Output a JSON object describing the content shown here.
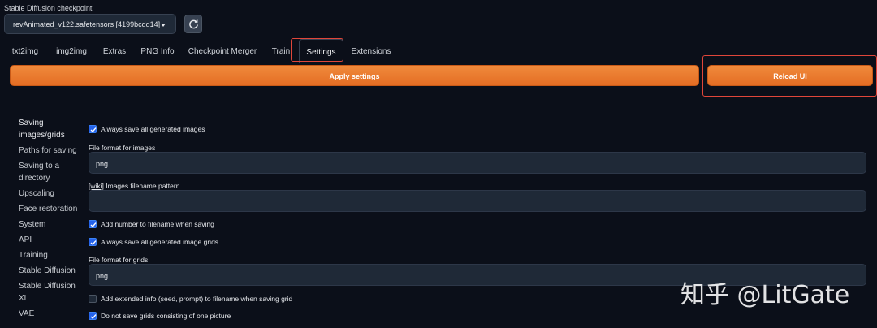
{
  "checkpoint": {
    "label": "Stable Diffusion checkpoint",
    "value": "revAnimated_v122.safetensors [4199bcdd14]",
    "refresh_icon": "refresh-icon"
  },
  "tabs": [
    {
      "label": "txt2img"
    },
    {
      "label": "img2img"
    },
    {
      "label": "Extras"
    },
    {
      "label": "PNG Info"
    },
    {
      "label": "Checkpoint Merger"
    },
    {
      "label": "Train"
    },
    {
      "label": "Settings",
      "active": true
    },
    {
      "label": "Extensions"
    }
  ],
  "actions": {
    "apply_label": "Apply settings",
    "reload_label": "Reload UI"
  },
  "sidebar": {
    "items": [
      {
        "label": "Saving images/grids",
        "active": true
      },
      {
        "label": "Paths for saving"
      },
      {
        "label": "Saving to a directory"
      },
      {
        "label": "Upscaling"
      },
      {
        "label": "Face restoration"
      },
      {
        "label": "System"
      },
      {
        "label": "API"
      },
      {
        "label": "Training"
      },
      {
        "label": "Stable Diffusion"
      },
      {
        "label": "Stable Diffusion XL"
      },
      {
        "label": "VAE"
      }
    ]
  },
  "settings": {
    "always_save_images": {
      "label": "Always save all generated images",
      "checked": true
    },
    "file_format_images": {
      "label": "File format for images",
      "value": "png"
    },
    "filename_pattern": {
      "wiki": "[wiki]",
      "label": " Images filename pattern",
      "value": ""
    },
    "add_number": {
      "label": "Add number to filename when saving",
      "checked": true
    },
    "always_save_grids": {
      "label": "Always save all generated image grids",
      "checked": true
    },
    "file_format_grids": {
      "label": "File format for grids",
      "value": "png"
    },
    "add_extended_info": {
      "label": "Add extended info (seed, prompt) to filename when saving grid",
      "checked": false
    },
    "no_single_grid": {
      "label": "Do not save grids consisting of one picture",
      "checked": true
    }
  },
  "watermark": "知乎 @LitGate",
  "colors": {
    "accent_orange": "#e46d24",
    "highlight_red": "#e0463a",
    "checkbox_blue": "#2563eb",
    "background": "#0b0f19"
  }
}
